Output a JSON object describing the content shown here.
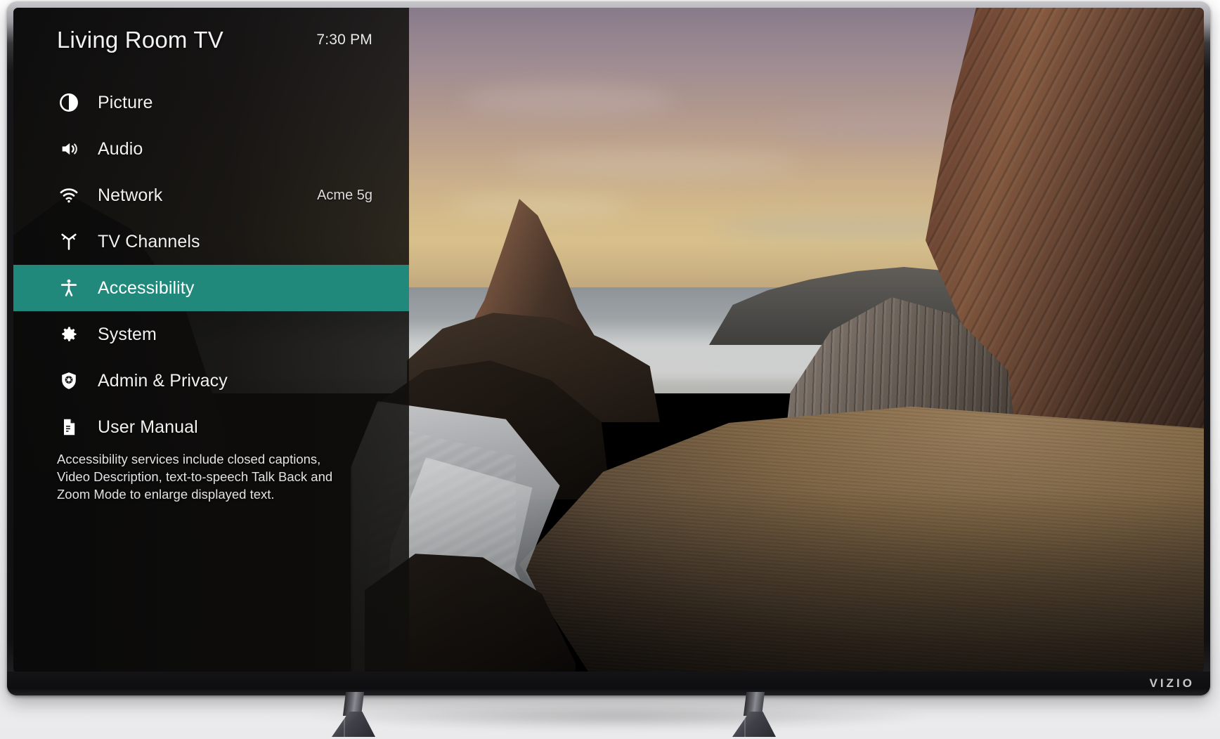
{
  "device": {
    "brand_logo": "VIZIO"
  },
  "menu": {
    "title": "Living Room TV",
    "clock": "7:30 PM",
    "accent_color": "#21897b",
    "items": [
      {
        "label": "Picture",
        "value": "",
        "icon": "contrast-icon",
        "selected": false
      },
      {
        "label": "Audio",
        "value": "",
        "icon": "speaker-icon",
        "selected": false
      },
      {
        "label": "Network",
        "value": "Acme 5g",
        "icon": "wifi-icon",
        "selected": false
      },
      {
        "label": "TV Channels",
        "value": "",
        "icon": "antenna-icon",
        "selected": false
      },
      {
        "label": "Accessibility",
        "value": "",
        "icon": "accessibility-icon",
        "selected": true
      },
      {
        "label": "System",
        "value": "",
        "icon": "gear-icon",
        "selected": false
      },
      {
        "label": "Admin & Privacy",
        "value": "",
        "icon": "shield-gear-icon",
        "selected": false
      },
      {
        "label": "User Manual",
        "value": "",
        "icon": "document-icon",
        "selected": false
      }
    ],
    "description": "Accessibility services include closed captions, Video Description, text-to-speech Talk Back and Zoom Mode to enlarge displayed text."
  },
  "wallpaper": {
    "scene": "coastal-sunset-beach"
  }
}
